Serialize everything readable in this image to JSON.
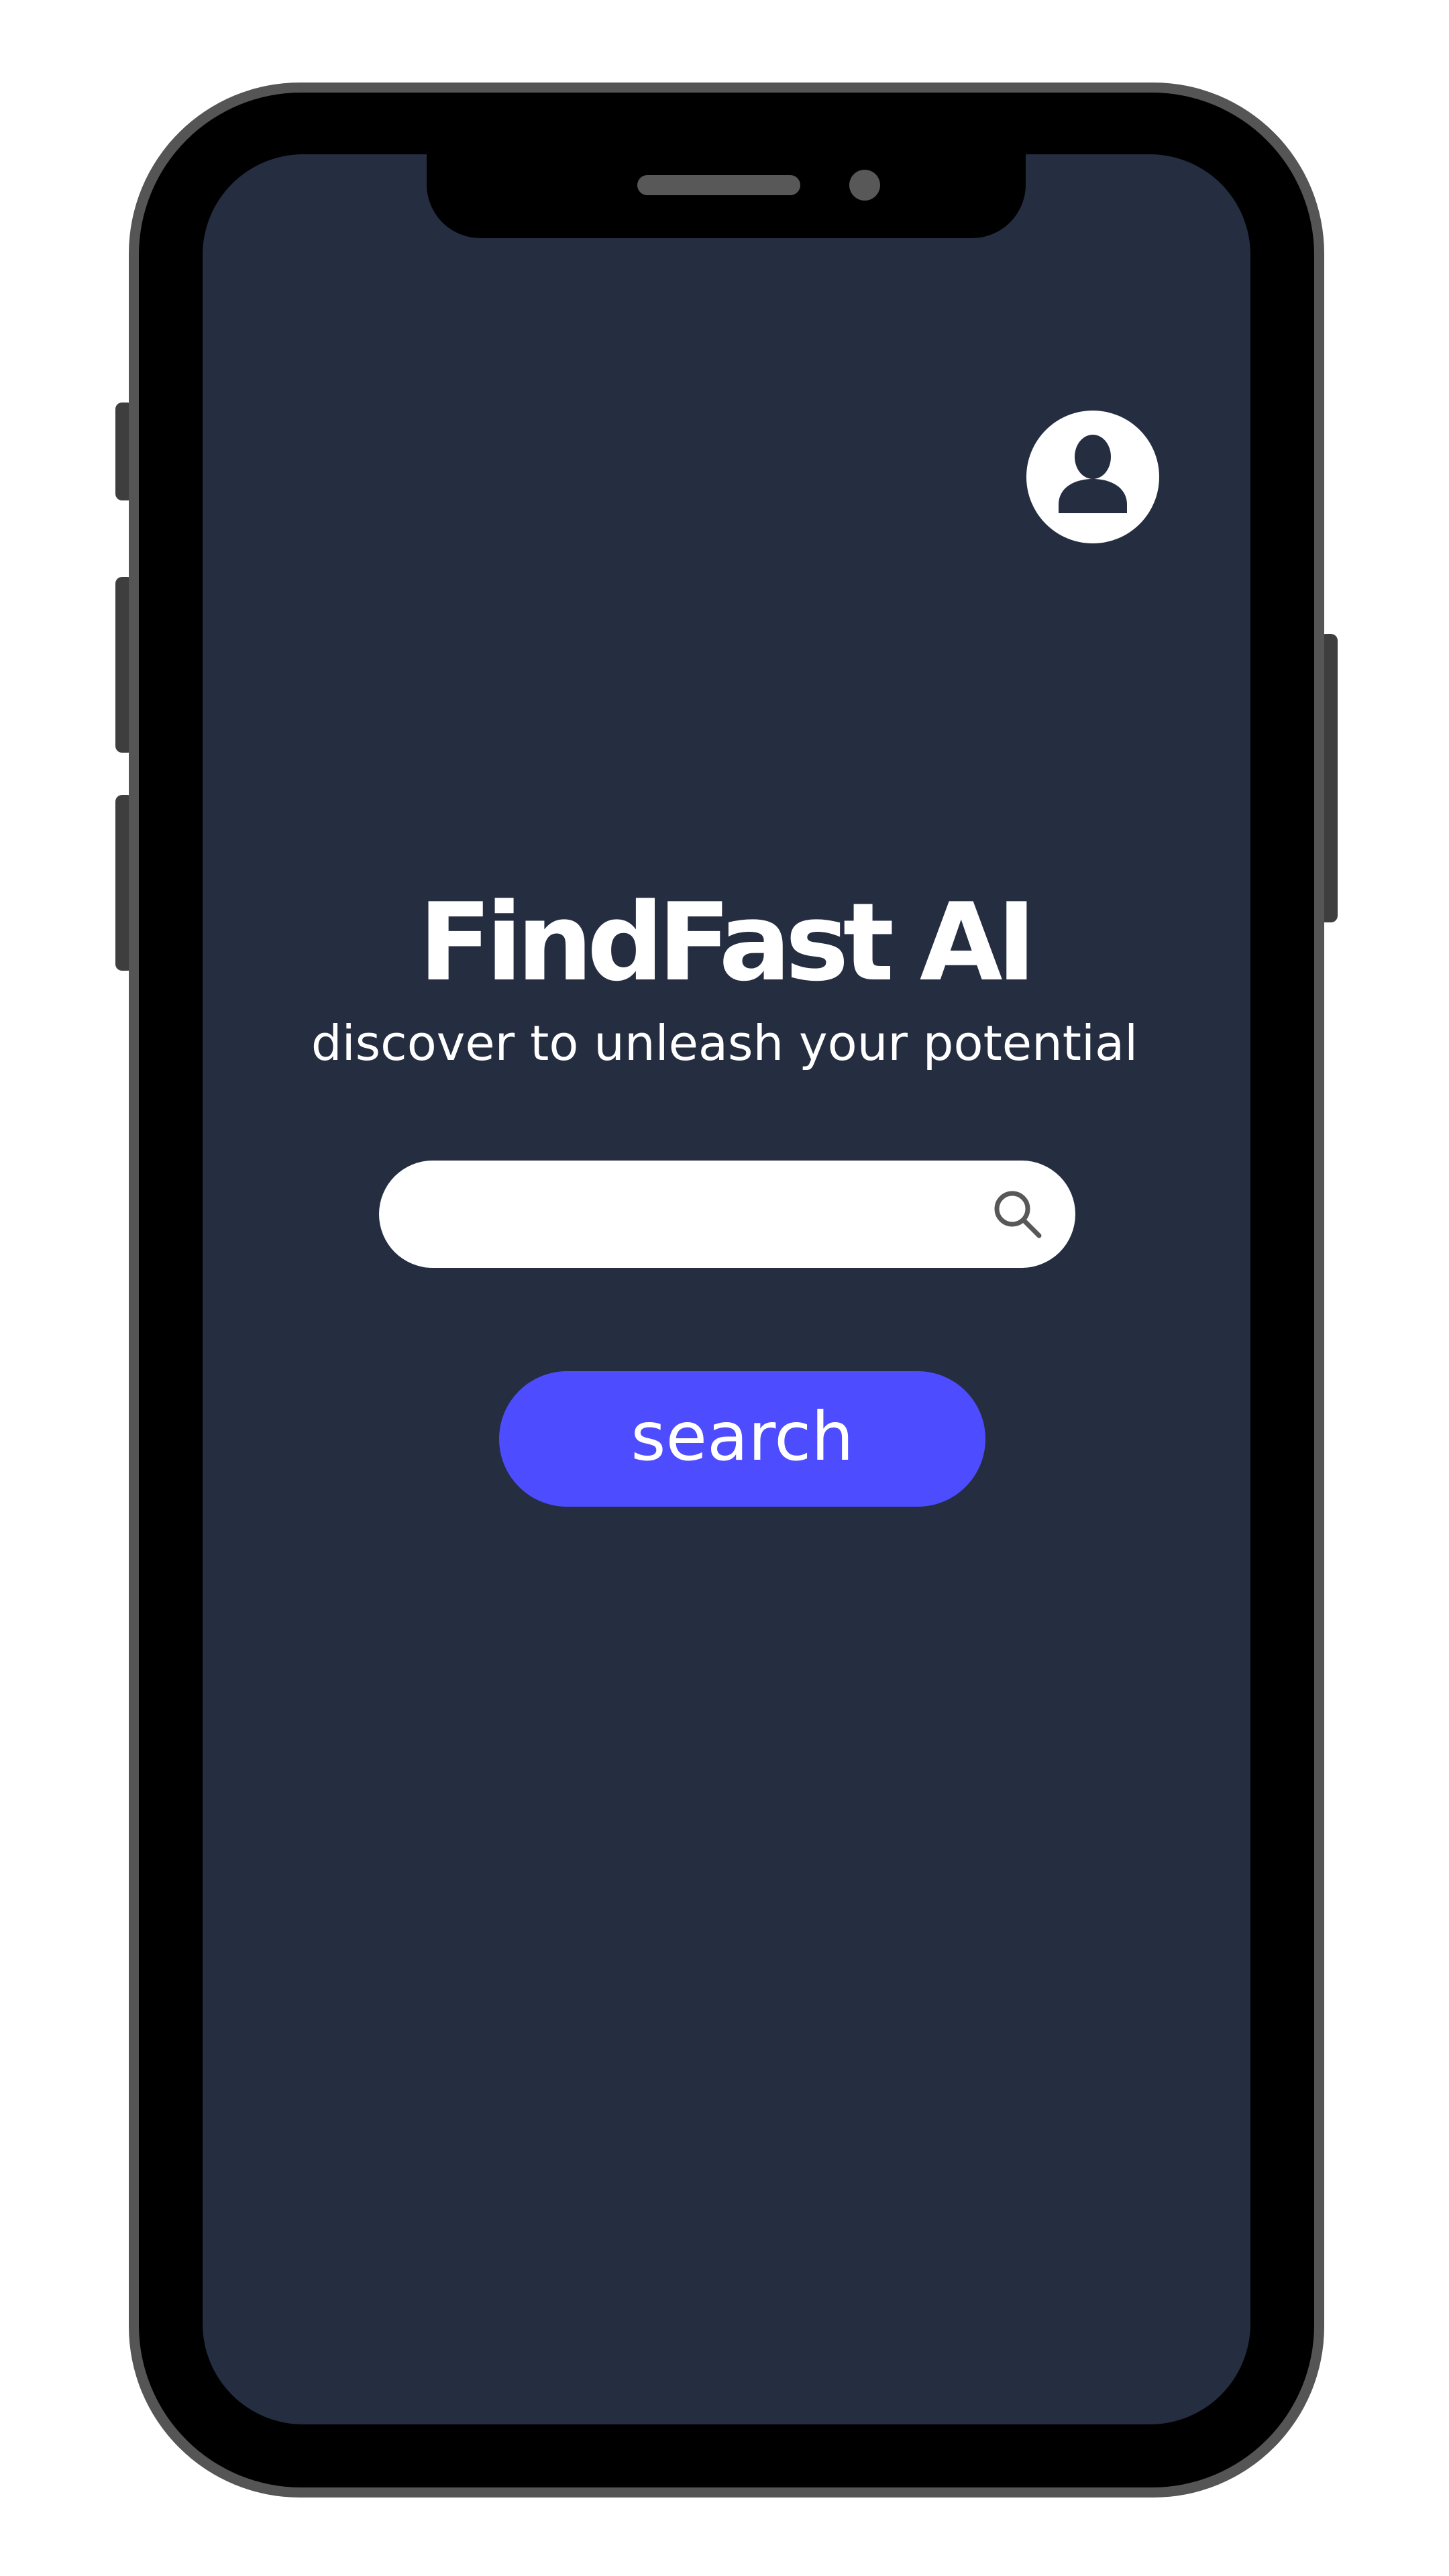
{
  "app": {
    "title": "FindFast AI",
    "tagline": "discover to unleash your potential"
  },
  "header": {
    "avatar_icon": "user-avatar-icon"
  },
  "search": {
    "value": "",
    "placeholder": "",
    "icon": "search-icon",
    "button_label": "search"
  },
  "colors": {
    "screen_background": "#252d41",
    "accent": "#4d4dff",
    "text": "#ffffff",
    "icon_gray": "#585858"
  }
}
